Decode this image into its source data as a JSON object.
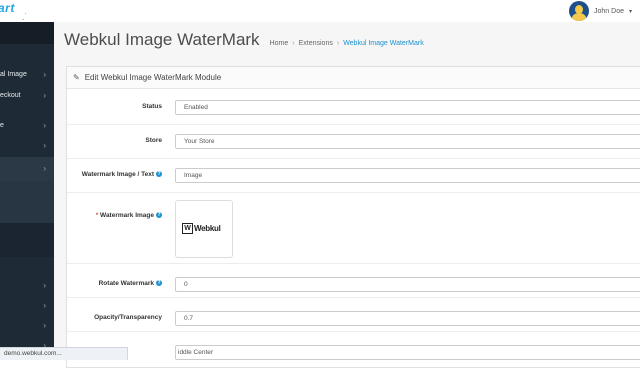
{
  "header": {
    "logo_text": "art",
    "logo_cart": ".˙",
    "user_name": "John Doe",
    "user_caret": "▾"
  },
  "sidebar": {
    "items": [
      {
        "label": "al Image",
        "chevron": "›"
      },
      {
        "label": "eckout",
        "chevron": "›"
      },
      {
        "label": "e",
        "chevron": "›"
      },
      {
        "label": "",
        "chevron": "›"
      },
      {
        "label": "",
        "chevron": "›"
      },
      {
        "label": "",
        "chevron": "›"
      },
      {
        "label": "",
        "chevron": "›"
      },
      {
        "label": "",
        "chevron": "›"
      },
      {
        "label": "",
        "chevron": "›"
      }
    ]
  },
  "page": {
    "title": "Webkul Image WaterMark",
    "breadcrumb": [
      {
        "label": "Home"
      },
      {
        "label": "Extensions"
      },
      {
        "label": "Webkul Image WaterMark"
      }
    ],
    "breadcrumb_sep": "›"
  },
  "panel": {
    "heading": "Edit Webkul Image WaterMark Module",
    "fields": {
      "status": {
        "label": "Status",
        "value": "Enabled"
      },
      "store": {
        "label": "Store",
        "value": "Your Store"
      },
      "watermark_type": {
        "label": "Watermark Image / Text",
        "value": "Image"
      },
      "watermark_image": {
        "label": "Watermark Image",
        "required_mark": "*",
        "logo_letter": "W",
        "logo_text": "Webkul"
      },
      "rotate": {
        "label": "Rotate Watermark",
        "value": "0"
      },
      "opacity": {
        "label": "Opacity/Transparency",
        "value": "0.7"
      },
      "position": {
        "value": "iddle Center"
      }
    },
    "help_icon": "?"
  },
  "statusbar": {
    "url": "demo.webkul.com..."
  },
  "colors": {
    "sidebar_bg": "#1e2a36",
    "accent": "#1e91cf",
    "required": "#d9534f",
    "logo": "#24a6e0"
  }
}
